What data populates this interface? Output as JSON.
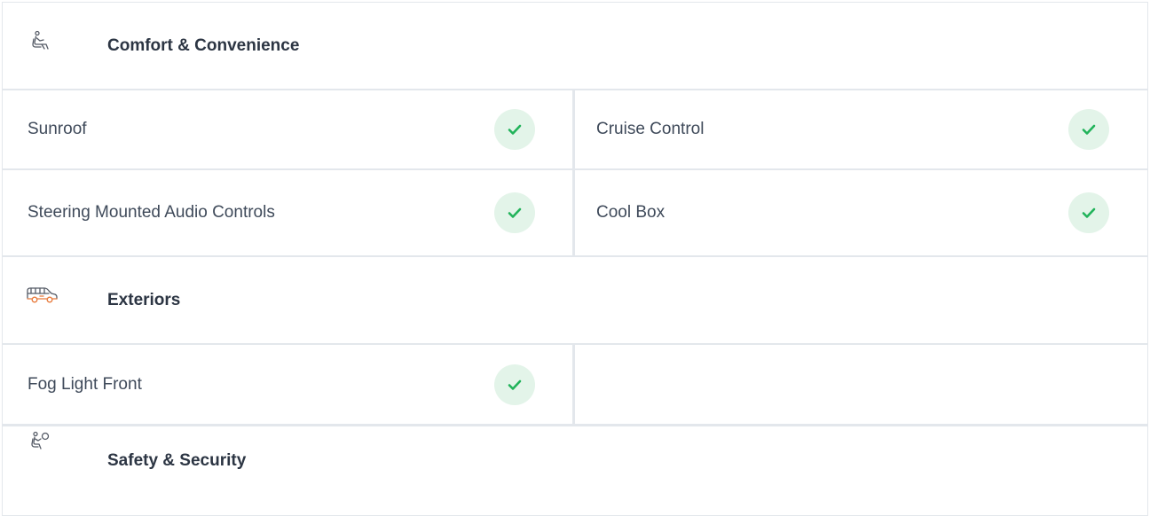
{
  "sections": [
    {
      "title": "Comfort & Convenience",
      "icon": "seat-icon",
      "rows": [
        [
          {
            "label": "Sunroof",
            "available": true
          },
          {
            "label": "Cruise Control",
            "available": true
          }
        ],
        [
          {
            "label": "Steering Mounted Audio Controls",
            "available": true
          },
          {
            "label": "Cool Box",
            "available": true
          }
        ]
      ]
    },
    {
      "title": "Exteriors",
      "icon": "car-icon",
      "rows": [
        [
          {
            "label": "Fog Light Front",
            "available": true
          },
          {
            "label": "",
            "available": false
          }
        ]
      ]
    },
    {
      "title": "Safety & Security",
      "icon": "airbag-icon",
      "rows": []
    }
  ],
  "colors": {
    "check_bg": "#e3f4e9",
    "check_mark": "#21b35a",
    "exterior_icon": "#e8793a",
    "border": "#e3e7ec"
  }
}
